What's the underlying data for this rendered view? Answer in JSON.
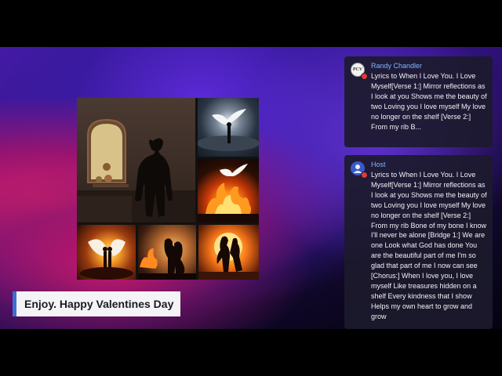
{
  "caption": {
    "text": "Enjoy. Happy Valentines Day"
  },
  "collage": {
    "tiles": [
      {
        "icon": "man-silhouette-mirror-icon"
      },
      {
        "icon": "dove-cloud-icon"
      },
      {
        "icon": "dove-fire-icon"
      },
      {
        "icon": "winged-couple-icon"
      },
      {
        "icon": "couple-fire-icon"
      },
      {
        "icon": "couple-sunset-icon"
      }
    ]
  },
  "comments": [
    {
      "author": "Randy Chandler",
      "avatar_text": "PCV",
      "avatar_icon": "channel-logo-icon",
      "text": "Lyrics to When I Love You. I Love Myself[Verse 1:] Mirror reflections as I look at you Shows me the beauty of two Loving you I love myself My love no longer on the shelf [Verse 2:] From my rib B..."
    },
    {
      "author": "Host",
      "avatar_icon": "host-avatar-icon",
      "text": "Lyrics to When I Love You. I Love Myself[Verse 1:] Mirror reflections as I look at you Shows me the beauty of two Loving you I love myself My love no longer on the shelf [Verse 2:] From my rib Bone of my bone I know I'll never be alone [Bridge 1:] We are one Look what God has done You are the beautiful part of me I'm so glad that part of me I now can see [Chorus:] When I love you, I love myself Like treasures hidden on a shelf Every kindness that I show Helps my own heart to grow and grow"
    }
  ],
  "colors": {
    "accent": "#3b6fd8",
    "author": "#7fb6ff",
    "badge": "#e03a3a"
  }
}
